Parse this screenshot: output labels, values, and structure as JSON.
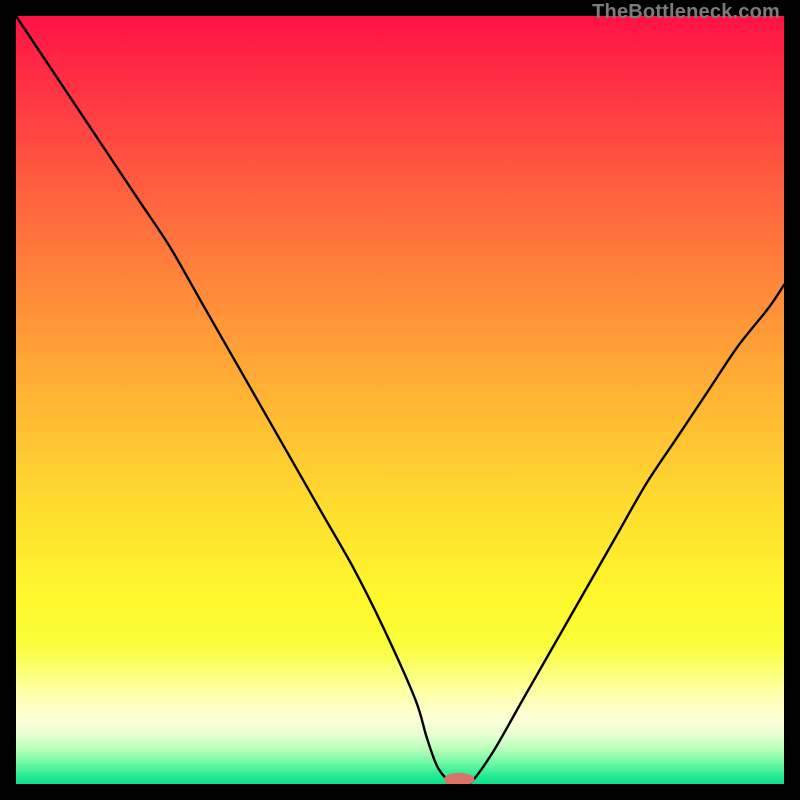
{
  "watermark": "TheBottleneck.com",
  "chart_data": {
    "type": "line",
    "title": "",
    "xlabel": "",
    "ylabel": "",
    "xlim": [
      0,
      100
    ],
    "ylim": [
      0,
      100
    ],
    "x": [
      0,
      4,
      8,
      12,
      16,
      20,
      24,
      28,
      32,
      36,
      40,
      44,
      48,
      52,
      53.5,
      55,
      57,
      59,
      62,
      66,
      70,
      74,
      78,
      82,
      86,
      90,
      94,
      98,
      100
    ],
    "y": [
      100,
      94,
      88,
      82,
      76,
      70,
      63,
      56,
      49,
      42,
      35,
      28,
      20,
      11,
      6,
      2,
      0,
      0,
      4,
      11,
      18,
      25,
      32,
      39,
      45,
      51,
      57,
      62,
      65
    ],
    "marker": {
      "x": 57.7,
      "y": 0.6,
      "rx": 2.0,
      "ry": 0.85,
      "color": "#d9736a"
    },
    "background_gradient": [
      {
        "offset": 0.0,
        "color": "#ff1244"
      },
      {
        "offset": 0.06,
        "color": "#ff2744"
      },
      {
        "offset": 0.13,
        "color": "#ff3f42"
      },
      {
        "offset": 0.21,
        "color": "#ff5a3f"
      },
      {
        "offset": 0.29,
        "color": "#ff743c"
      },
      {
        "offset": 0.37,
        "color": "#ff8d39"
      },
      {
        "offset": 0.45,
        "color": "#ffa636"
      },
      {
        "offset": 0.53,
        "color": "#ffbe33"
      },
      {
        "offset": 0.61,
        "color": "#ffd530"
      },
      {
        "offset": 0.69,
        "color": "#ffe92e"
      },
      {
        "offset": 0.76,
        "color": "#fff82d"
      },
      {
        "offset": 0.82,
        "color": "#f8ff3a"
      },
      {
        "offset": 0.88,
        "color": "#ffffa6"
      },
      {
        "offset": 0.915,
        "color": "#fdffd6"
      },
      {
        "offset": 0.935,
        "color": "#e8ffd3"
      },
      {
        "offset": 0.955,
        "color": "#b7ffba"
      },
      {
        "offset": 0.975,
        "color": "#63f7a0"
      },
      {
        "offset": 0.992,
        "color": "#1de98f"
      },
      {
        "offset": 1.0,
        "color": "#0fdd8b"
      }
    ]
  }
}
